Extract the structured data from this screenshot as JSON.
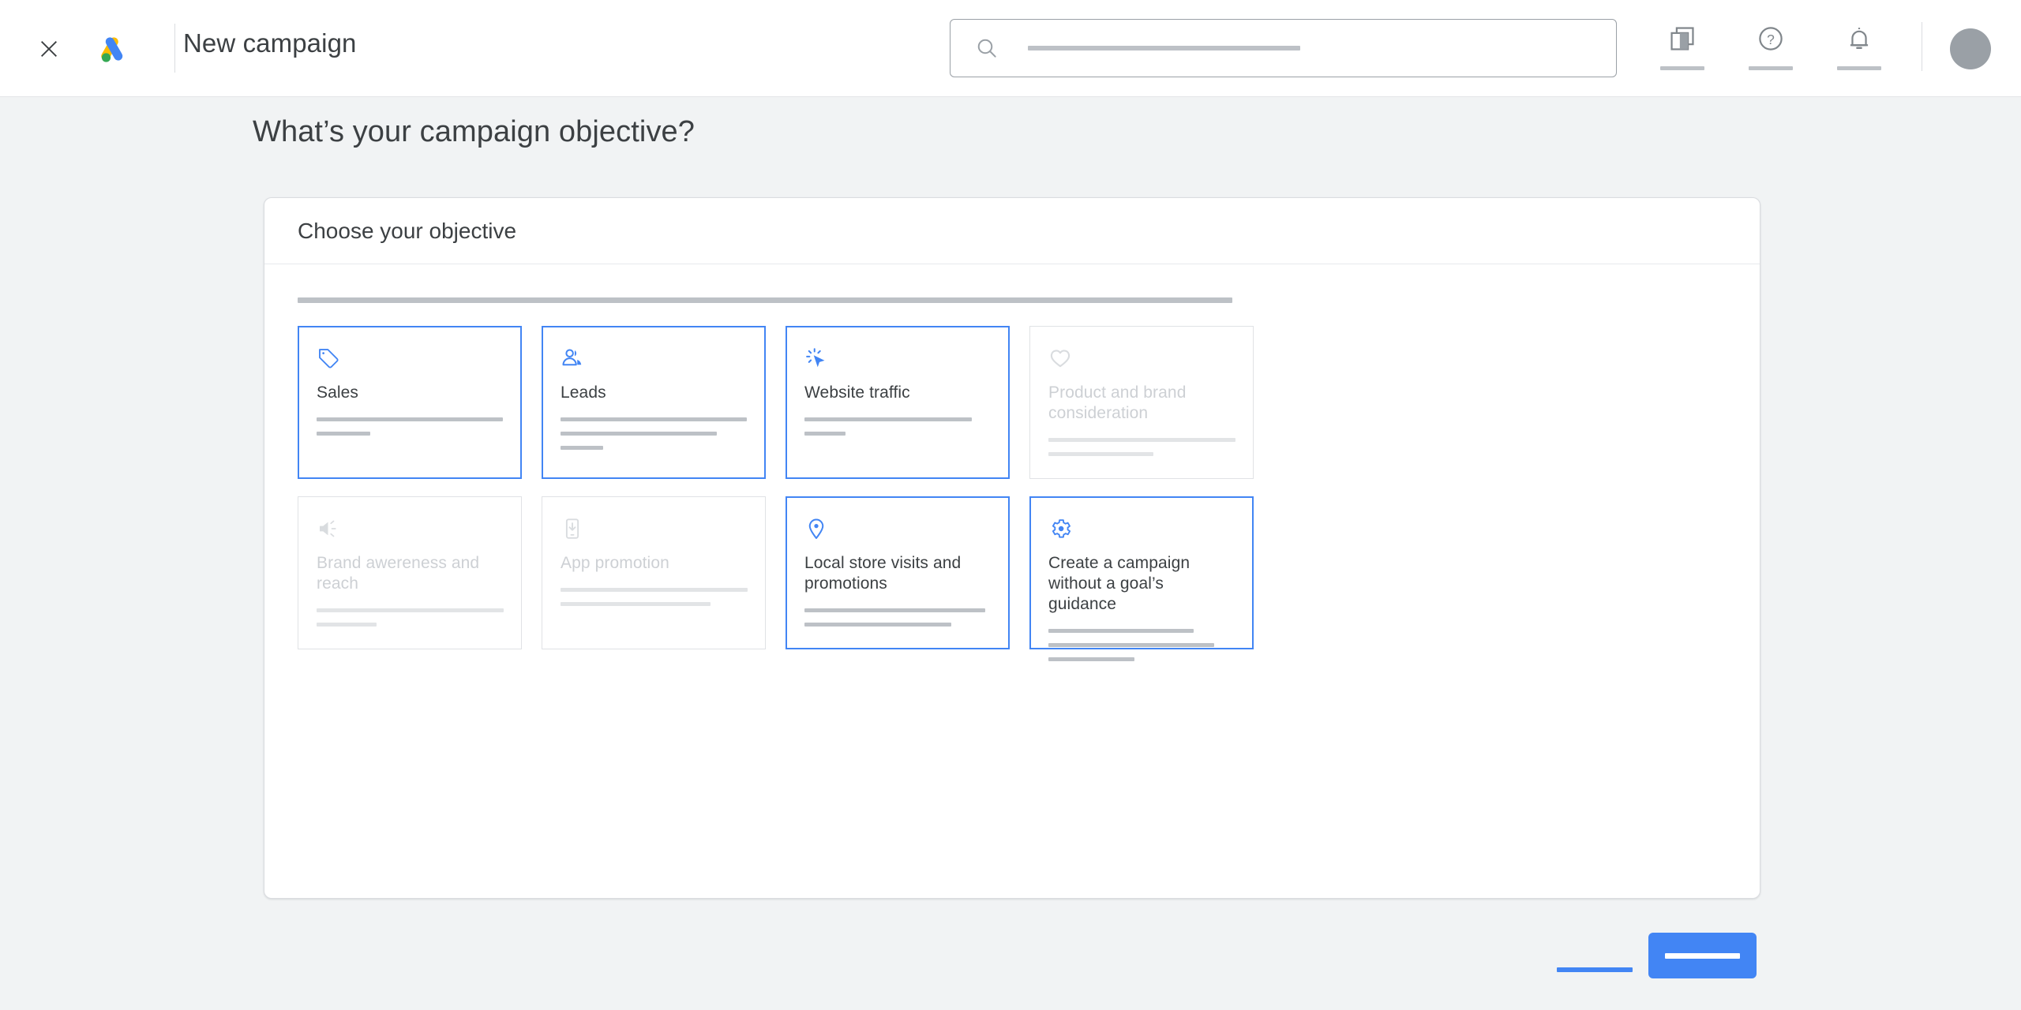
{
  "header": {
    "close_icon": "close-icon",
    "logo_icon": "google-ads-logo",
    "title": "New campaign",
    "search": {
      "icon": "search-icon",
      "value": "",
      "placeholder": "",
      "redacted": true
    },
    "icons": [
      {
        "name": "reports-icon",
        "redacted_label": true
      },
      {
        "name": "help-icon",
        "redacted_label": true
      },
      {
        "name": "notifications-bell-icon",
        "redacted_label": true
      }
    ],
    "avatar": {
      "name": "avatar",
      "redacted": true
    }
  },
  "page": {
    "headline": "What’s your campaign objective?"
  },
  "panel": {
    "title": "Choose your objective",
    "description_redacted": true
  },
  "objectives": [
    {
      "id": "sales",
      "label": "Sales",
      "icon": "tag-icon",
      "selected": true,
      "disabled": false,
      "desc_lines": [
        100,
        29
      ]
    },
    {
      "id": "leads",
      "label": "Leads",
      "icon": "people-icon",
      "selected": true,
      "disabled": false,
      "desc_lines": [
        100,
        84,
        23
      ]
    },
    {
      "id": "website-traffic",
      "label": "Website traffic",
      "icon": "ad-click-icon",
      "selected": true,
      "disabled": false,
      "desc_lines": [
        90,
        22
      ]
    },
    {
      "id": "product-and-brand-consideration",
      "label": "Product and brand consideration",
      "icon": "heart-icon",
      "selected": false,
      "disabled": true,
      "desc_lines": [
        100,
        56
      ]
    },
    {
      "id": "brand-awareness-and-reach",
      "label": "Brand awereness and reach",
      "icon": "speaker-icon",
      "selected": false,
      "disabled": true,
      "desc_lines": [
        100,
        32
      ]
    },
    {
      "id": "app-promotion",
      "label": "App promotion",
      "icon": "mobile-download-icon",
      "selected": false,
      "disabled": true,
      "desc_lines": [
        100,
        80
      ]
    },
    {
      "id": "local-store-visits-and-promotions",
      "label": "Local store visits and promotions",
      "icon": "location-pin-icon",
      "selected": true,
      "disabled": false,
      "desc_lines": [
        97,
        79
      ]
    },
    {
      "id": "create-a-campaign-without-a-goals-guidance",
      "label": "Create a campaign without a goal’s guidance",
      "icon": "gear-icon",
      "selected": true,
      "disabled": false,
      "desc_lines": [
        78,
        89,
        46
      ]
    }
  ],
  "footer": {
    "secondary_button": {
      "name": "cancel-button",
      "redacted_label": true
    },
    "primary_button": {
      "name": "continue-button",
      "redacted_label": true
    }
  },
  "colors": {
    "accent_blue": "#4285f4",
    "page_bg": "#f1f3f4",
    "card_bg": "#ffffff",
    "text": "#3c4043",
    "disabled_text": "#cdd0d4",
    "redaction_gray": "#bdc1c6",
    "border_gray": "#dadce0"
  }
}
